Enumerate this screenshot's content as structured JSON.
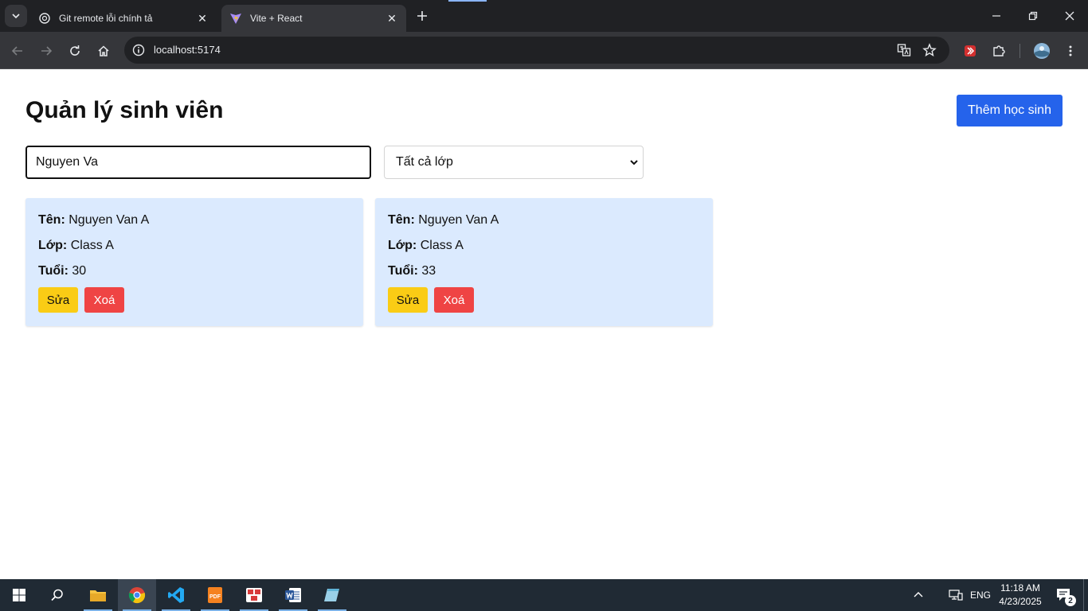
{
  "browser": {
    "tabs": [
      {
        "title": "Git remote lỗi chính tả",
        "active": false
      },
      {
        "title": "Vite + React",
        "active": true
      }
    ],
    "url": "localhost:5174"
  },
  "app": {
    "title": "Quản lý sinh viên",
    "add_button": "Thêm học sinh",
    "search": {
      "value": "Nguyen Va"
    },
    "class_filter": {
      "selected": "Tất cả lớp"
    },
    "labels": {
      "name": "Tên:",
      "class": "Lớp:",
      "age": "Tuổi:"
    },
    "actions": {
      "edit": "Sửa",
      "delete": "Xoá"
    },
    "students": [
      {
        "name": "Nguyen Van A",
        "class": "Class A",
        "age": "30"
      },
      {
        "name": "Nguyen Van A",
        "class": "Class A",
        "age": "33"
      }
    ]
  },
  "taskbar": {
    "language": "ENG",
    "time": "11:18 AM",
    "date": "4/23/2025",
    "notification_count": "2"
  },
  "colors": {
    "primary": "#2563eb",
    "card_bg": "#dbeafe",
    "edit": "#facc15",
    "delete": "#ef4444"
  }
}
